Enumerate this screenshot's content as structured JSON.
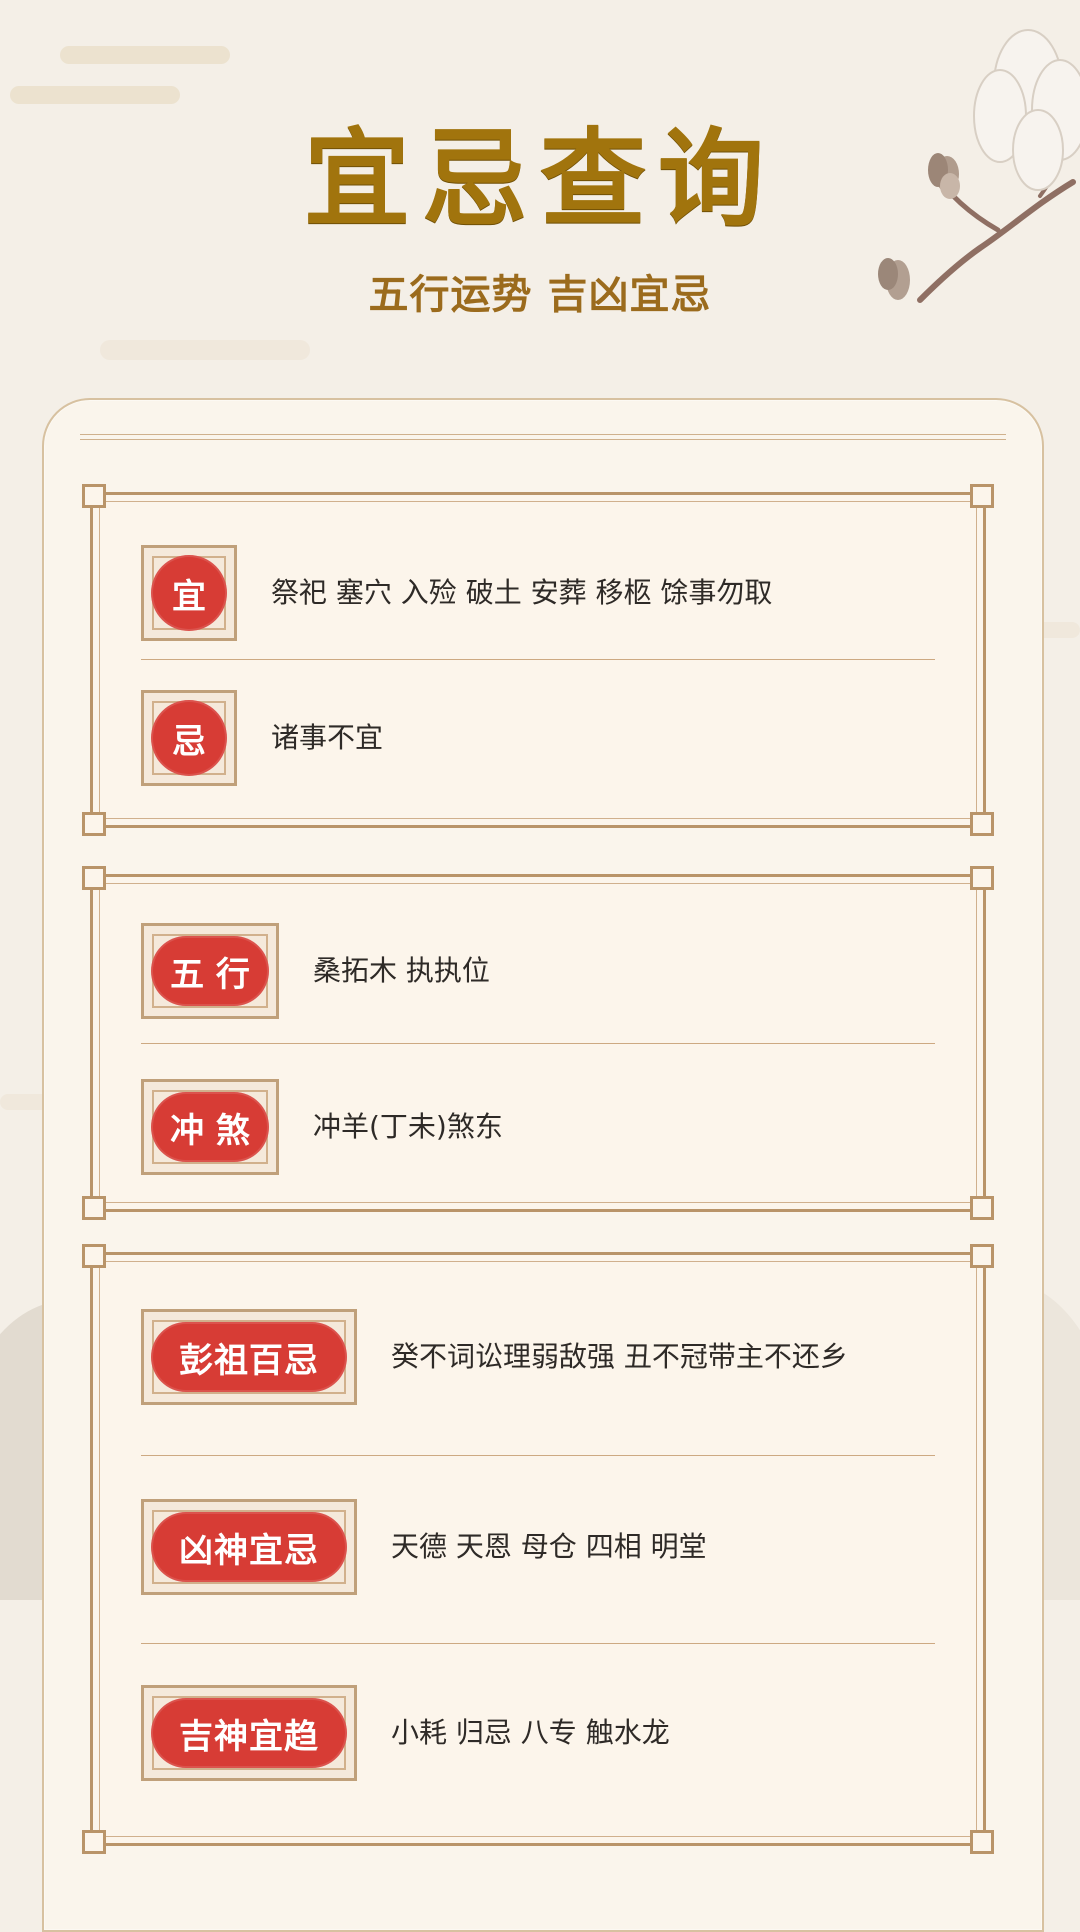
{
  "header": {
    "title": "宜忌查询",
    "subtitle": "五行运势  吉凶宜忌"
  },
  "sections": [
    {
      "rows": [
        {
          "label": "宜",
          "text": "祭祀 塞穴 入殓 破土 安葬 移柩 馀事勿取"
        },
        {
          "label": "忌",
          "text": "诸事不宜"
        }
      ]
    },
    {
      "rows": [
        {
          "label": "五 行",
          "text": "桑拓木 执执位"
        },
        {
          "label": "冲 煞",
          "text": "冲羊(丁未)煞东"
        }
      ]
    },
    {
      "rows": [
        {
          "label": "彭祖百忌",
          "text": "癸不词讼理弱敌强 丑不冠带主不还乡"
        },
        {
          "label": "凶神宜忌",
          "text": "天德 天恩 母仓 四相 明堂"
        },
        {
          "label": "吉神宜趋",
          "text": "小耗 归忌 八专 触水龙"
        }
      ]
    }
  ],
  "colors": {
    "accent_gold": "#a1740d",
    "seal_red": "#d73c35",
    "frame_brown": "#b99469",
    "background": "#f4efe7"
  },
  "icons": {
    "flower_branch": "magnolia-branch-icon",
    "clouds": "cloud-pattern-icon",
    "mountains": "mountain-landscape-icon"
  }
}
